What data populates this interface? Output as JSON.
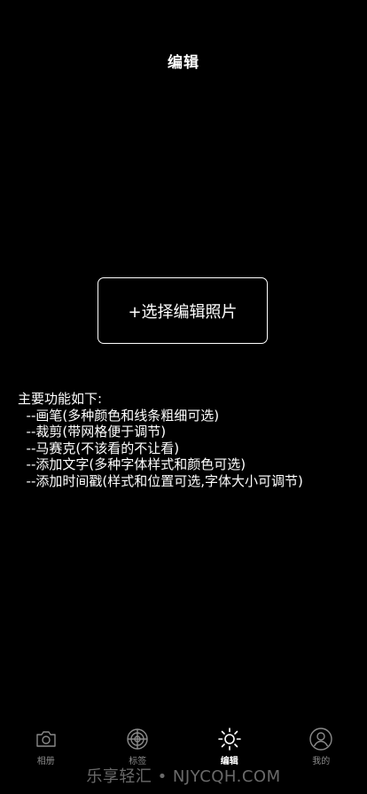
{
  "header": {
    "title": "编辑"
  },
  "main": {
    "select_button_label": "+选择编辑照片",
    "features_title": "主要功能如下:",
    "features": [
      "  --画笔(多种颜色和线条粗细可选)",
      "  --裁剪(带网格便于调节)",
      "  --马赛克(不该看的不让看)",
      "  --添加文字(多种字体样式和颜色可选)",
      "  --添加时间戳(样式和位置可选,字体大小可调节)"
    ]
  },
  "tabbar": {
    "tabs": [
      {
        "label": "相册",
        "icon": "camera-icon",
        "active": false
      },
      {
        "label": "标签",
        "icon": "target-icon",
        "active": false
      },
      {
        "label": "编辑",
        "icon": "sun-icon",
        "active": true
      },
      {
        "label": "我的",
        "icon": "user-icon",
        "active": false
      }
    ]
  },
  "watermark": "乐享轻汇 • NJYCQH.COM",
  "colors": {
    "background": "#000000",
    "text": "#ffffff",
    "inactive_tab": "#8a8a8a",
    "watermark": "#6a6a6a"
  }
}
